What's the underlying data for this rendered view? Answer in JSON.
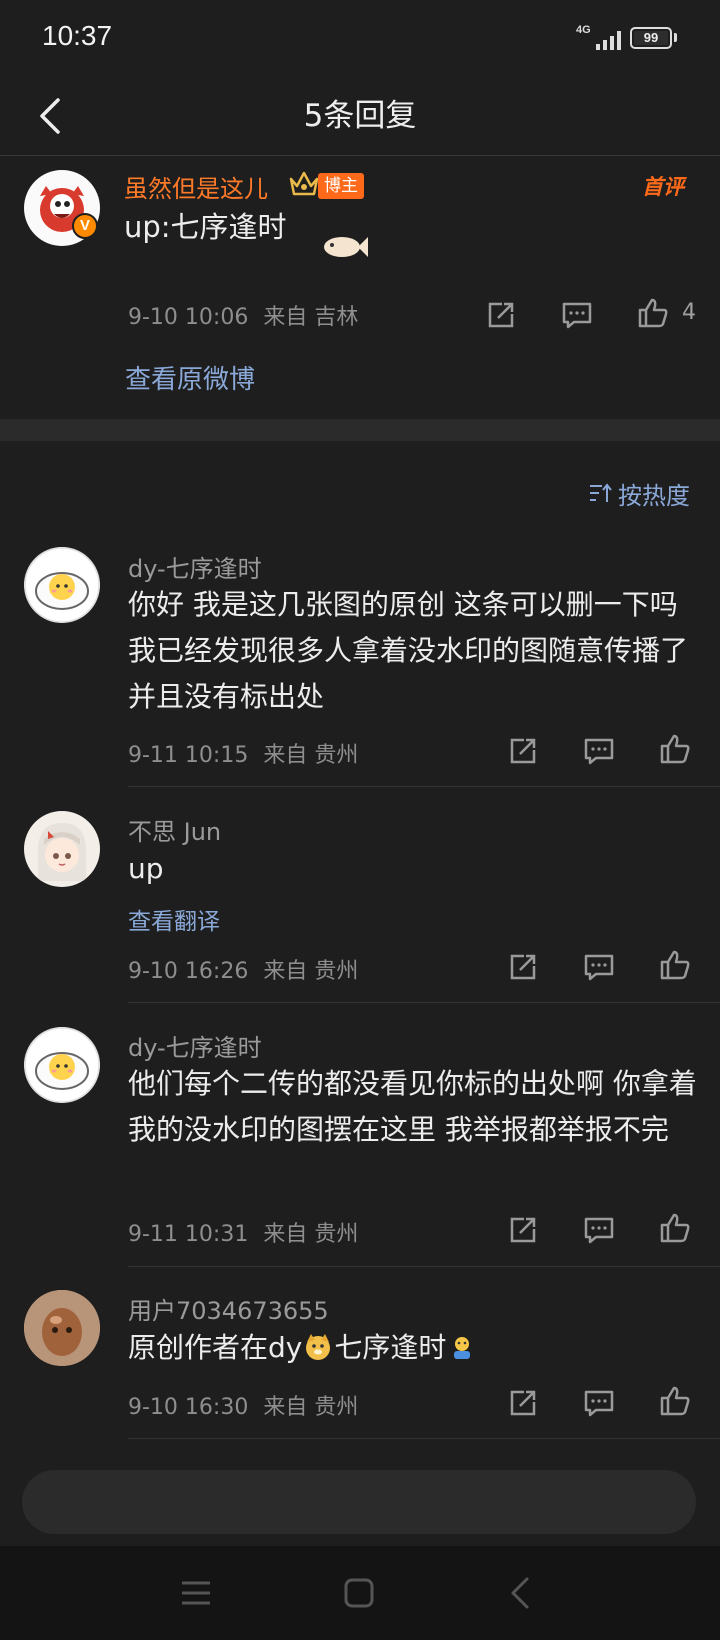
{
  "status": {
    "time": "10:37",
    "network": "4G",
    "battery": "99",
    "battery_level": 0.99
  },
  "nav": {
    "title": "5条回复"
  },
  "main_comment": {
    "username": "虽然但是这儿",
    "badge": "博主",
    "first_comment_badge": "首评",
    "text": "up:七序逢时",
    "time": "9-10 10:06",
    "location": "来自 吉林",
    "likes": "4",
    "view_original": "查看原微博"
  },
  "sort": {
    "label": "按热度"
  },
  "replies": [
    {
      "username": "dy-七序逢时",
      "text": "你好 我是这几张图的原创 这条可以删一下吗 我已经发现很多人拿着没水印的图随意传播了 并且没有标出处",
      "time": "9-11 10:15",
      "location": "来自 贵州"
    },
    {
      "username": "不思 Jun",
      "text": "up",
      "translate": "查看翻译",
      "time": "9-10 16:26",
      "location": "来自 贵州"
    },
    {
      "username": "dy-七序逢时",
      "text": "他们每个二传的都没看见你标的出处啊 你拿着我的没水印的图摆在这里 我举报都举报不完",
      "time": "9-11 10:31",
      "location": "来自 贵州"
    },
    {
      "username": "用户7034673655",
      "text_before": "原创作者在dy",
      "text_after": "七序逢时",
      "time": "9-10 16:30",
      "location": "来自 贵州"
    }
  ],
  "colors": {
    "background": "#1e1e1e",
    "link": "#8aa8d8",
    "username_highlight": "#ff7a28"
  }
}
